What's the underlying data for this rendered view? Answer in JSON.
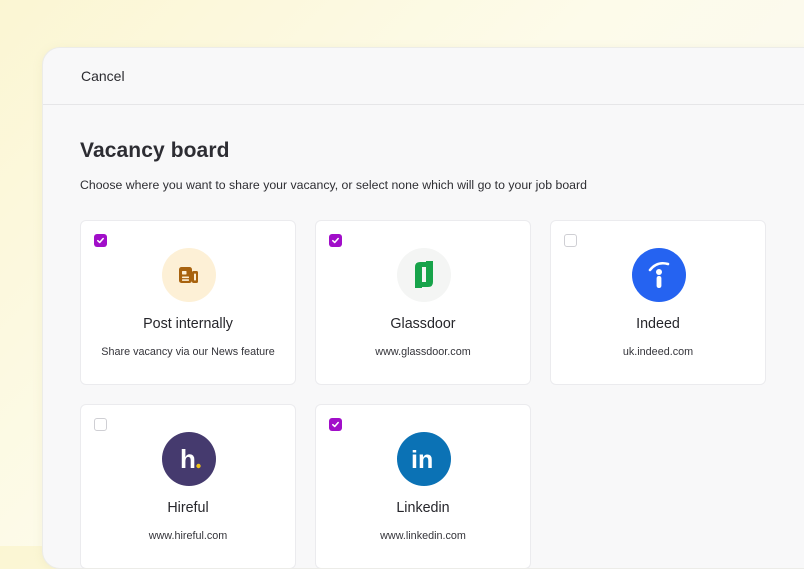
{
  "header": {
    "cancel_label": "Cancel"
  },
  "main": {
    "title": "Vacancy board",
    "subtitle": "Choose where you want to share your vacancy, or select none which will go to your job board"
  },
  "colors": {
    "checkbox_checked": "#a10ec9",
    "post_internally_bg": "#fdf0d6",
    "post_internally_icon": "#a8630f",
    "glassdoor_bg": "#f4f5f4",
    "glassdoor_green": "#17a34a",
    "indeed_blue": "#2563f1",
    "hireful_purple": "#453a6e",
    "hireful_dot": "#f2c417",
    "linkedin_blue": "#0b72b5"
  },
  "boards": [
    {
      "name": "Post internally",
      "description": "Share vacancy via our News feature",
      "checked": true,
      "icon": "newspaper-icon"
    },
    {
      "name": "Glassdoor",
      "description": "www.glassdoor.com",
      "checked": true,
      "icon": "glassdoor-logo"
    },
    {
      "name": "Indeed",
      "description": "uk.indeed.com",
      "checked": false,
      "icon": "indeed-logo"
    },
    {
      "name": "Hireful",
      "description": "www.hireful.com",
      "checked": false,
      "icon": "hireful-logo"
    },
    {
      "name": "Linkedin",
      "description": "www.linkedin.com",
      "checked": true,
      "icon": "linkedin-logo"
    }
  ]
}
